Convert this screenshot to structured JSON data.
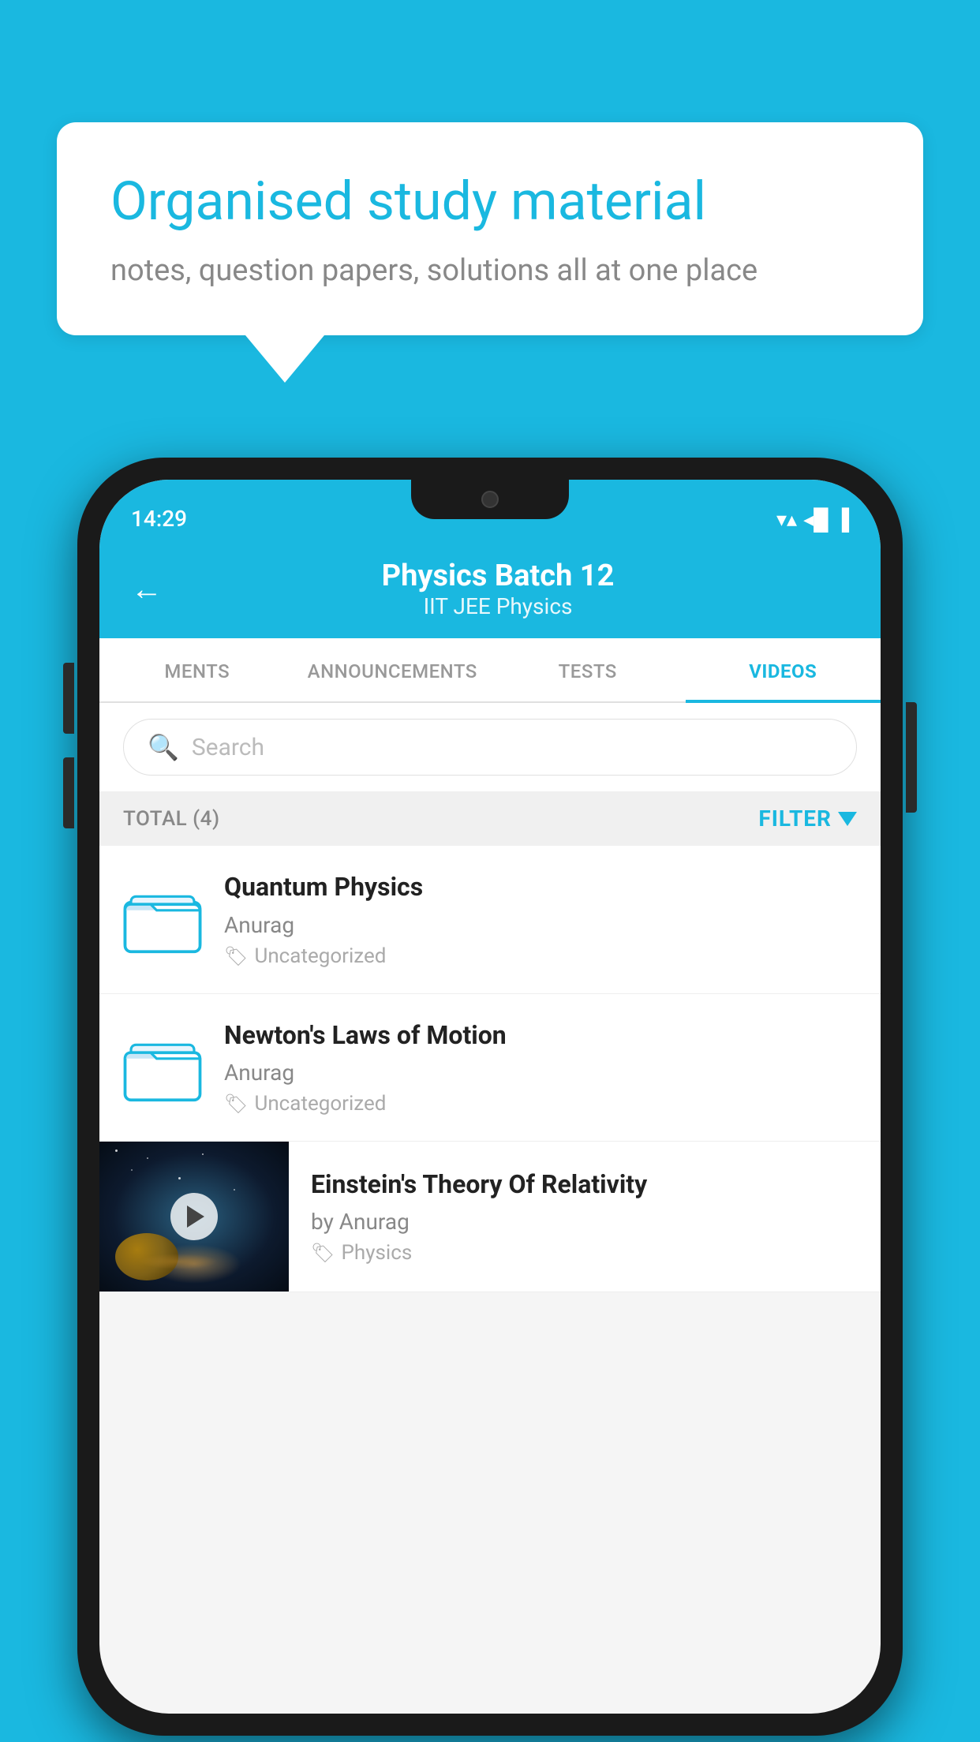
{
  "background_color": "#1ab8e0",
  "speech_bubble": {
    "title": "Organised study material",
    "subtitle": "notes, question papers, solutions all at one place"
  },
  "status_bar": {
    "time": "14:29",
    "wifi": "▼▲",
    "battery": "▐"
  },
  "header": {
    "back_label": "←",
    "title": "Physics Batch 12",
    "subtitle": "IIT JEE   Physics"
  },
  "tabs": [
    {
      "label": "MENTS",
      "active": false
    },
    {
      "label": "ANNOUNCEMENTS",
      "active": false
    },
    {
      "label": "TESTS",
      "active": false
    },
    {
      "label": "VIDEOS",
      "active": true
    }
  ],
  "search": {
    "placeholder": "Search"
  },
  "filter_row": {
    "total_label": "TOTAL (4)",
    "filter_label": "FILTER"
  },
  "videos": [
    {
      "id": 1,
      "title": "Quantum Physics",
      "author": "Anurag",
      "tag": "Uncategorized",
      "type": "folder"
    },
    {
      "id": 2,
      "title": "Newton's Laws of Motion",
      "author": "Anurag",
      "tag": "Uncategorized",
      "type": "folder"
    },
    {
      "id": 3,
      "title": "Einstein's Theory Of Relativity",
      "author": "by Anurag",
      "tag": "Physics",
      "type": "video"
    }
  ]
}
